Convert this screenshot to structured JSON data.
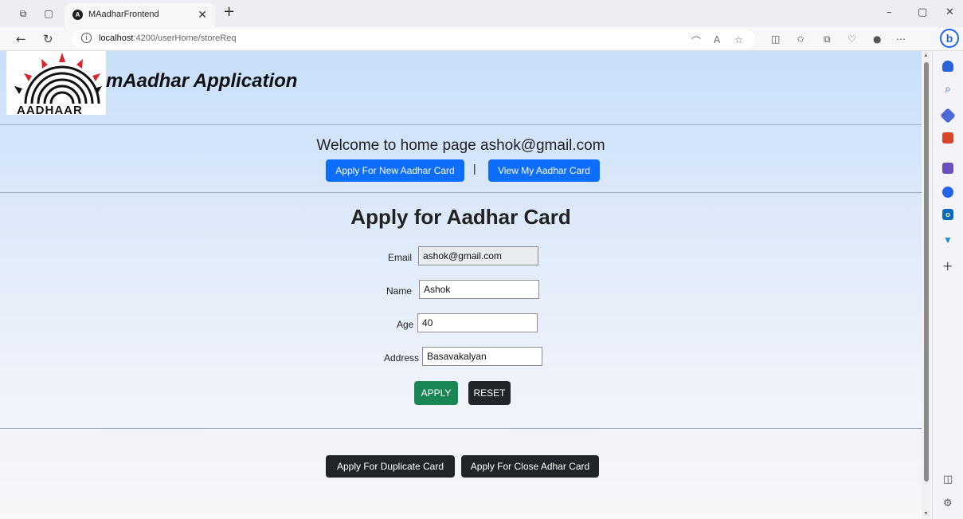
{
  "browser": {
    "tab_title": "MAadharFrontend",
    "url_host": "localhost",
    "url_path": ":4200/userHome/storeReq"
  },
  "header": {
    "logo_text": "AADHAAR",
    "app_title": "mAadhar Application"
  },
  "welcome": {
    "text": "Welcome to home page ashok@gmail.com",
    "apply_new_label": "Apply For New Aadhar Card",
    "separator": "|",
    "view_label": "View My Aadhar Card"
  },
  "form": {
    "title": "Apply for Aadhar Card",
    "email_label": "Email",
    "email_value": "ashok@gmail.com",
    "name_label": "Name",
    "name_value": "Ashok",
    "age_label": "Age",
    "age_value": "40",
    "address_label": "Address",
    "address_value": "Basavakalyan",
    "apply_label": "APPLY",
    "reset_label": "RESET"
  },
  "footer": {
    "duplicate_label": "Apply For Duplicate Card",
    "close_label": "Apply For Close Adhar Card"
  },
  "colors": {
    "primary": "#0d6efd",
    "dark": "#212529",
    "success": "#198754"
  }
}
